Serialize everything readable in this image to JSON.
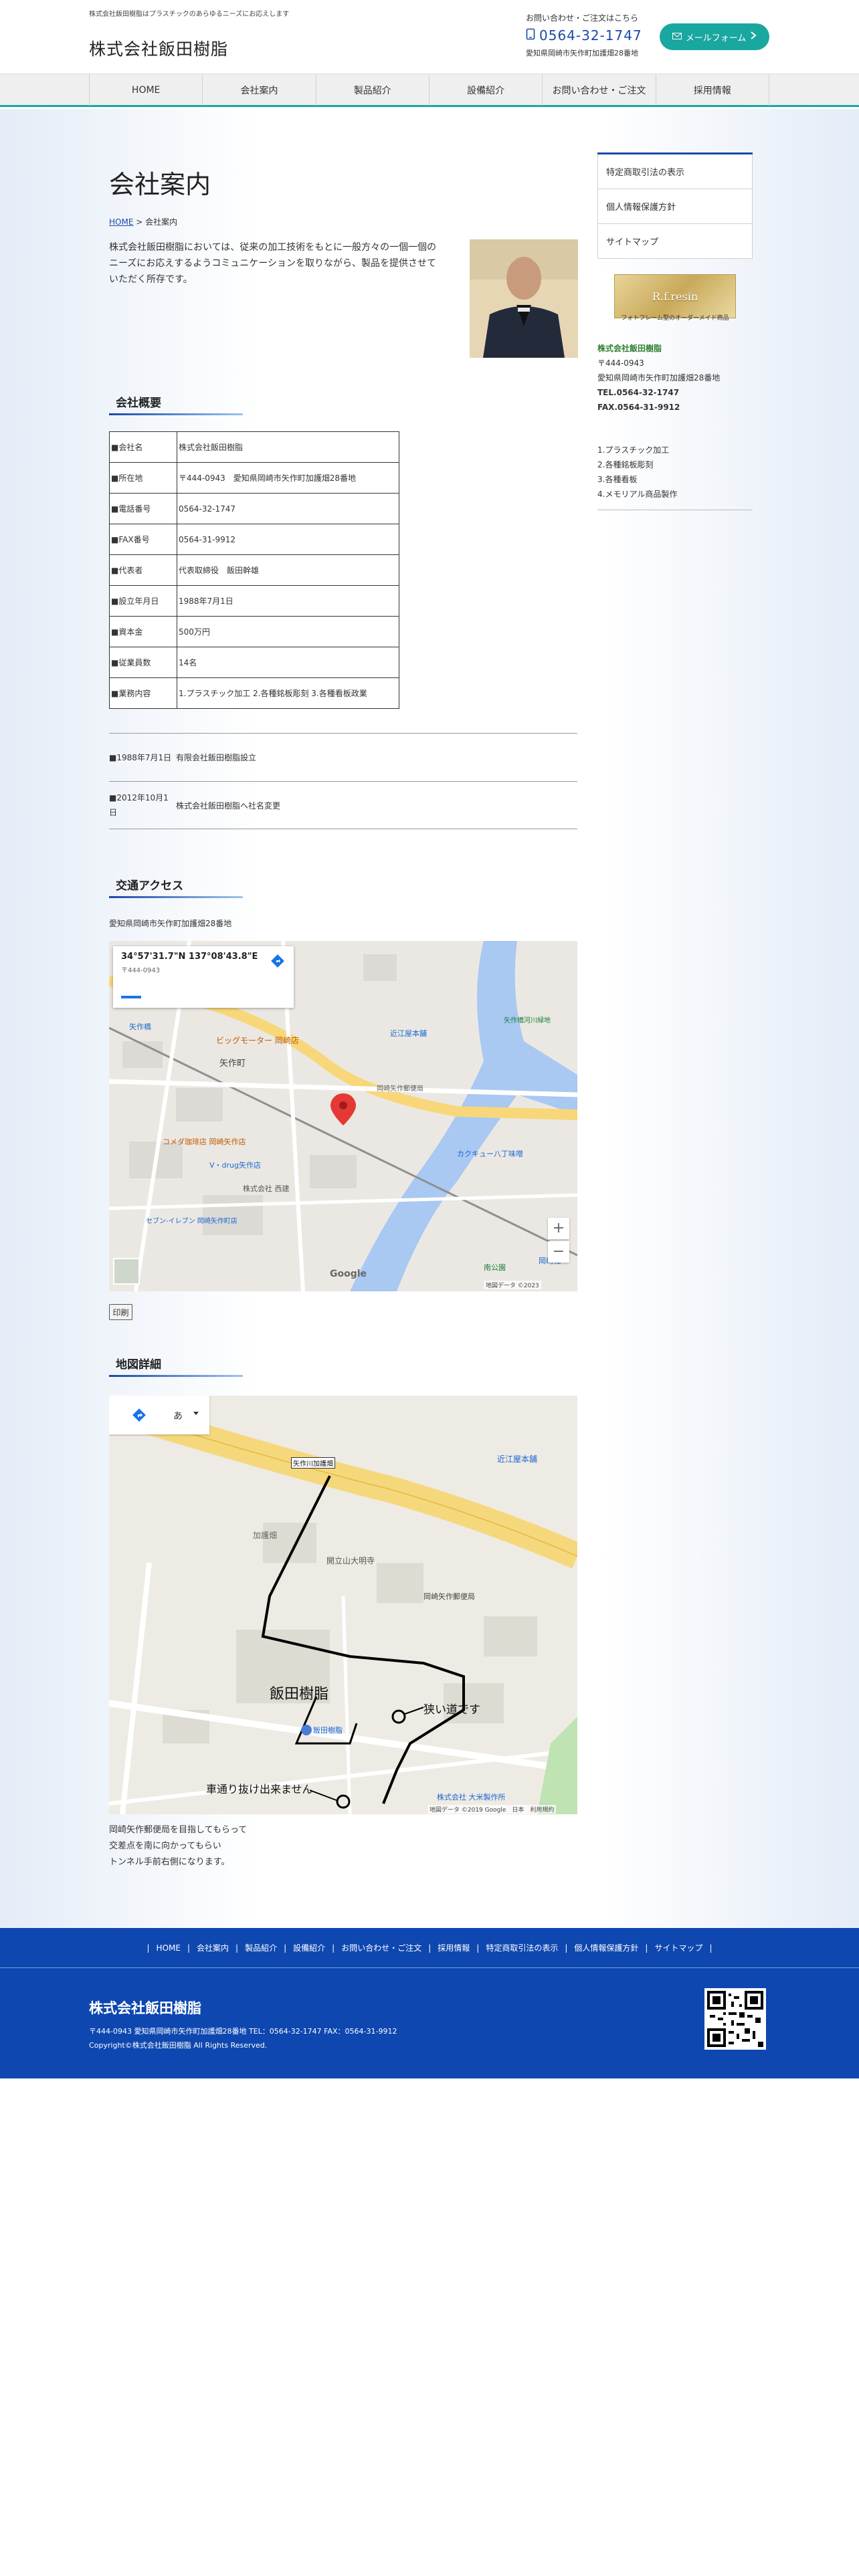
{
  "header": {
    "tagline": "株式会社飯田樹脂はプラスチックのあらゆるニーズにお応えします",
    "site_title": "株式会社飯田樹脂",
    "contact_note": "お問い合わせ・ご注文はこちら",
    "tel": "0564-32-1747",
    "address": "愛知県岡崎市矢作町加護畑28番地",
    "mail_button": "メールフォーム"
  },
  "nav": [
    "HOME",
    "会社案内",
    "製品紹介",
    "設備紹介",
    "お問い合わせ・ご注文",
    "採用情報"
  ],
  "main": {
    "page_title": "会社案内",
    "breadcrumb_home": "HOME",
    "breadcrumb_sep": " > ",
    "breadcrumb_current": "会社案内",
    "intro": "株式会社飯田樹脂においては、従来の加工技術をもとに一般方々の一個一個のニーズにお応えするようコミュニケーションを取りながら、製品を提供させていただく所存です。",
    "outline_heading": "会社概要",
    "outline": [
      {
        "key": "■会社名",
        "value": "株式会社飯田樹脂"
      },
      {
        "key": "■所在地",
        "value": "〒444-0943　愛知県岡崎市矢作町加護畑28番地"
      },
      {
        "key": "■電話番号",
        "value": "0564-32-1747"
      },
      {
        "key": "■FAX番号",
        "value": "0564-31-9912"
      },
      {
        "key": "■代表者",
        "value": "代表取締役　飯田幹雄"
      },
      {
        "key": "■設立年月日",
        "value": "1988年7月1日"
      },
      {
        "key": "■資本金",
        "value": "500万円"
      },
      {
        "key": "■従業員数",
        "value": "14名"
      },
      {
        "key": "■業務内容",
        "value": "1.プラスチック加工 2.各種銘板彫刻 3.各種看板政業"
      }
    ],
    "history": [
      {
        "date": "■1988年7月1日",
        "text": "有限会社飯田樹脂設立"
      },
      {
        "date": "■2012年10月1日",
        "text": "株式会社飯田樹脂へ社名変更"
      }
    ],
    "access_heading": "交通アクセス",
    "access_address": "愛知県岡崎市矢作町加護畑28番地",
    "map1": {
      "coords": "34°57'31.7\"N 137°08'43.8\"E",
      "place": "〒444-0943",
      "labels": [
        "矢作橋",
        "ビッグモーター 岡崎店",
        "近江屋本舗",
        "矢作町",
        "矢作橋河川緑地",
        "岡崎矢作郵便局",
        "コメダ珈琲店 岡崎矢作店",
        "V・drug矢作店",
        "株式会社 西建",
        "セブン-イレブン 岡崎矢作町店",
        "カクキュー八丁味噌",
        "南公園",
        "岡崎城"
      ],
      "zoom_in": "+",
      "zoom_out": "−",
      "google": "Google",
      "copyright": "地図データ ©2023"
    },
    "print_label": "印刷",
    "detail_heading": "地図詳細",
    "map2": {
      "labels": [
        "矢作川加護畑",
        "飯田樹脂",
        "狭い道です",
        "車通り抜け出来ません",
        "岡崎矢作郵便局",
        "近江屋本舗",
        "開立山大明寺",
        "加護畑",
        "株式会社 大米製作所",
        "飯田樹脂"
      ],
      "input_label": "あ",
      "copyright": "地図データ ©2019 Google　日本　利用規約"
    },
    "directions": [
      "岡崎矢作郵便局を目指してもらって",
      "交差点を南に向かってもらい",
      "トンネル手前右側になります。"
    ]
  },
  "sidebar": {
    "menu": [
      "特定商取引法の表示",
      "個人情報保護方針",
      "サイトマップ"
    ],
    "banner_title": "R.f.resin",
    "banner_sub": "フォトフレーム型のオーダーメイド商品",
    "company_name": "株式会社飯田樹脂",
    "zip": "〒444-0943",
    "address": "愛知県岡崎市矢作町加護畑28番地",
    "tel": "TEL.0564-32-1747",
    "fax": "FAX.0564-31-9912",
    "business": [
      "1.プラスチック加工",
      "2.各種銘板彫刻",
      "3.各種看板",
      "4.メモリアル商品製作"
    ]
  },
  "footer": {
    "nav": [
      "HOME",
      "会社案内",
      "製品紹介",
      "設備紹介",
      "お問い合わせ・ご注文",
      "採用情報",
      "特定商取引法の表示",
      "個人情報保護方針",
      "サイトマップ"
    ],
    "company": "株式会社飯田樹脂",
    "address_line": "〒444-0943 愛知県岡崎市矢作町加護畑28番地 TEL：0564-32-1747  FAX：0564-31-9912",
    "copyright": "Copyright©株式会社飯田樹脂 All Rights Reserved."
  },
  "colors": {
    "accent": "#19a7a0",
    "brand_blue": "#0e47b0",
    "link": "#1a4aa8"
  }
}
